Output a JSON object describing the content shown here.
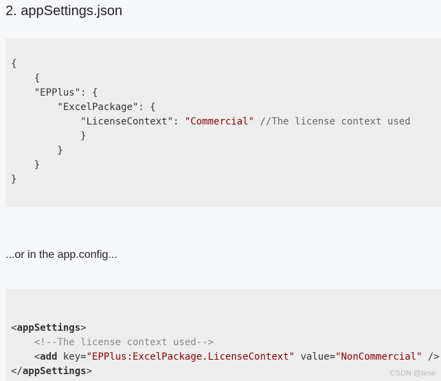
{
  "heading": "2. appSettings.json",
  "json_block": {
    "l1": "{",
    "l2": "    {",
    "l3": "    \"EPPlus\": {",
    "l4": "        \"ExcelPackage\": {",
    "l5_key": "            \"LicenseContext\": ",
    "l5_value": "\"Commercial\"",
    "l5_comment": " //The license context used",
    "l6": "            }",
    "l7": "        }",
    "l8": "    }",
    "l9": "}"
  },
  "paragraph": "...or in the app.config...",
  "xml_block": {
    "l1_open": "<",
    "l1_tag": "appSettings",
    "l1_close": ">",
    "l2_indent": "    ",
    "l2_comment": "<!--The license context used-->",
    "l3_indent": "    <",
    "l3_tag": "add",
    "l3_attr1": " key=",
    "l3_val1": "\"EPPlus:ExcelPackage.LicenseContext\"",
    "l3_attr2": " value=",
    "l3_val2": "\"NonCommercial\"",
    "l3_end": " />",
    "l4_open": "</",
    "l4_tag": "appSettings",
    "l4_close": ">"
  },
  "watermark": "CSDN @time"
}
